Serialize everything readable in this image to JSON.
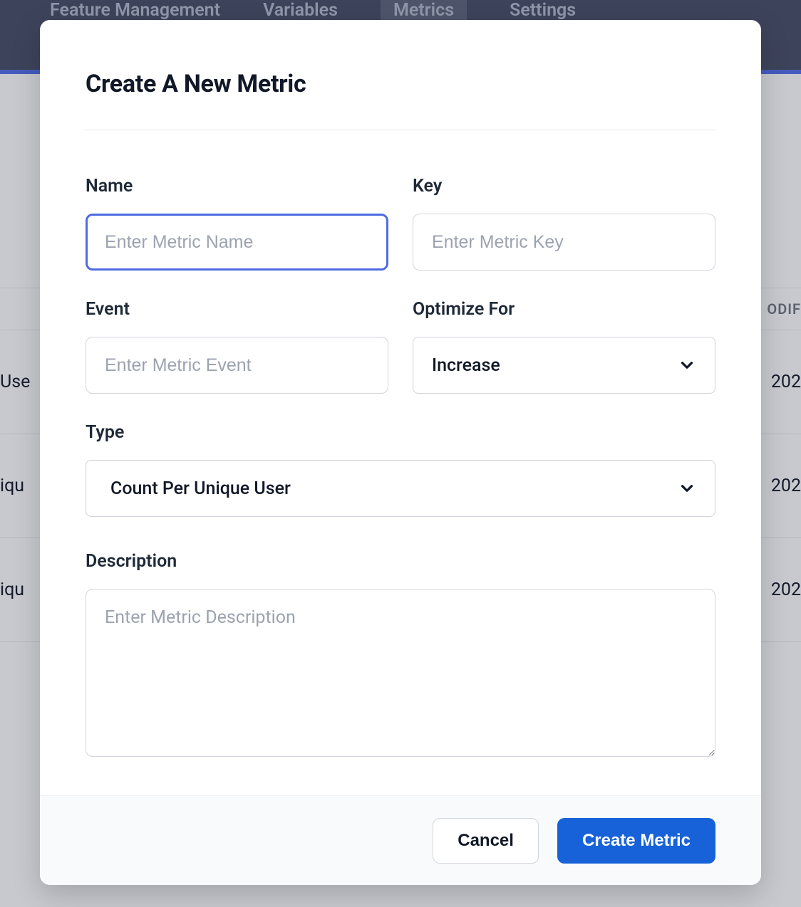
{
  "nav": {
    "items": [
      {
        "label": "Feature Management",
        "active": false
      },
      {
        "label": "Variables",
        "active": false
      },
      {
        "label": "Metrics",
        "active": true
      },
      {
        "label": "Settings",
        "active": false
      }
    ]
  },
  "background_table": {
    "column_label_fragment": "ODIF",
    "rows": [
      {
        "left_fragment": "Use",
        "right_fragment": "202"
      },
      {
        "left_fragment": "iqu",
        "right_fragment": "202"
      },
      {
        "left_fragment": "iqu",
        "right_fragment": "202"
      }
    ]
  },
  "modal": {
    "title": "Create A New Metric",
    "fields": {
      "name": {
        "label": "Name",
        "placeholder": "Enter Metric Name",
        "value": "",
        "focused": true
      },
      "key": {
        "label": "Key",
        "placeholder": "Enter Metric Key",
        "value": ""
      },
      "event": {
        "label": "Event",
        "placeholder": "Enter Metric Event",
        "value": ""
      },
      "optimize_for": {
        "label": "Optimize For",
        "value": "Increase"
      },
      "type": {
        "label": "Type",
        "value": "Count Per Unique User"
      },
      "description": {
        "label": "Description",
        "placeholder": "Enter Metric Description",
        "value": ""
      }
    },
    "buttons": {
      "cancel": "Cancel",
      "submit": "Create Metric"
    }
  }
}
